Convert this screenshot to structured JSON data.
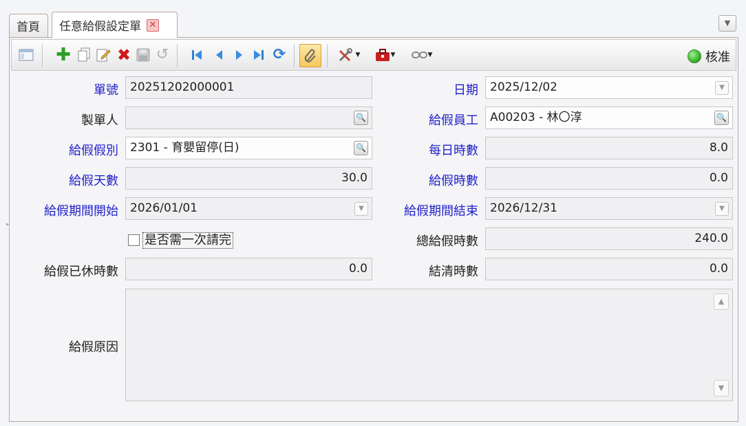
{
  "tabs": {
    "home": "首頁",
    "active": "任意給假設定單",
    "close_icon": "close-icon"
  },
  "toolbar": {
    "icons": [
      "list-view-icon",
      "add-icon",
      "copy-icon",
      "edit-icon",
      "delete-icon",
      "save-icon",
      "undo-icon",
      "first-record-icon",
      "previous-record-icon",
      "next-record-icon",
      "last-record-icon",
      "refresh-icon",
      "attachment-icon",
      "tools-icon",
      "toolbox-icon",
      "link-icon"
    ],
    "approve_label": "核准",
    "approve_color": "#2fa823"
  },
  "form": {
    "doc_no_label": "單號",
    "doc_no_value": "20251202000001",
    "date_label": "日期",
    "date_value": "2025/12/02",
    "creator_label": "製單人",
    "creator_value": "",
    "employee_label": "給假員工",
    "employee_value": "A00203 - 林〇淳",
    "leave_type_label": "給假假別",
    "leave_type_value": "2301 - 育嬰留停(日)",
    "daily_hours_label": "每日時數",
    "daily_hours_value": "8.0",
    "leave_days_label": "給假天數",
    "leave_days_value": "30.0",
    "leave_hours_label": "給假時數",
    "leave_hours_value": "0.0",
    "period_start_label": "給假期間開始",
    "period_start_value": "2026/01/01",
    "period_end_label": "給假期間結束",
    "period_end_value": "2026/12/31",
    "one_time_label": "是否需一次請完",
    "one_time_checked": false,
    "total_hours_label": "總給假時數",
    "total_hours_value": "240.0",
    "used_hours_label": "給假已休時數",
    "used_hours_value": "0.0",
    "settled_hours_label": "結清時數",
    "settled_hours_value": "0.0",
    "reason_label": "給假原因",
    "reason_value": ""
  },
  "colors": {
    "required_label": "#2222cc",
    "normal_label": "#222222",
    "border": "#b9a6a0"
  }
}
